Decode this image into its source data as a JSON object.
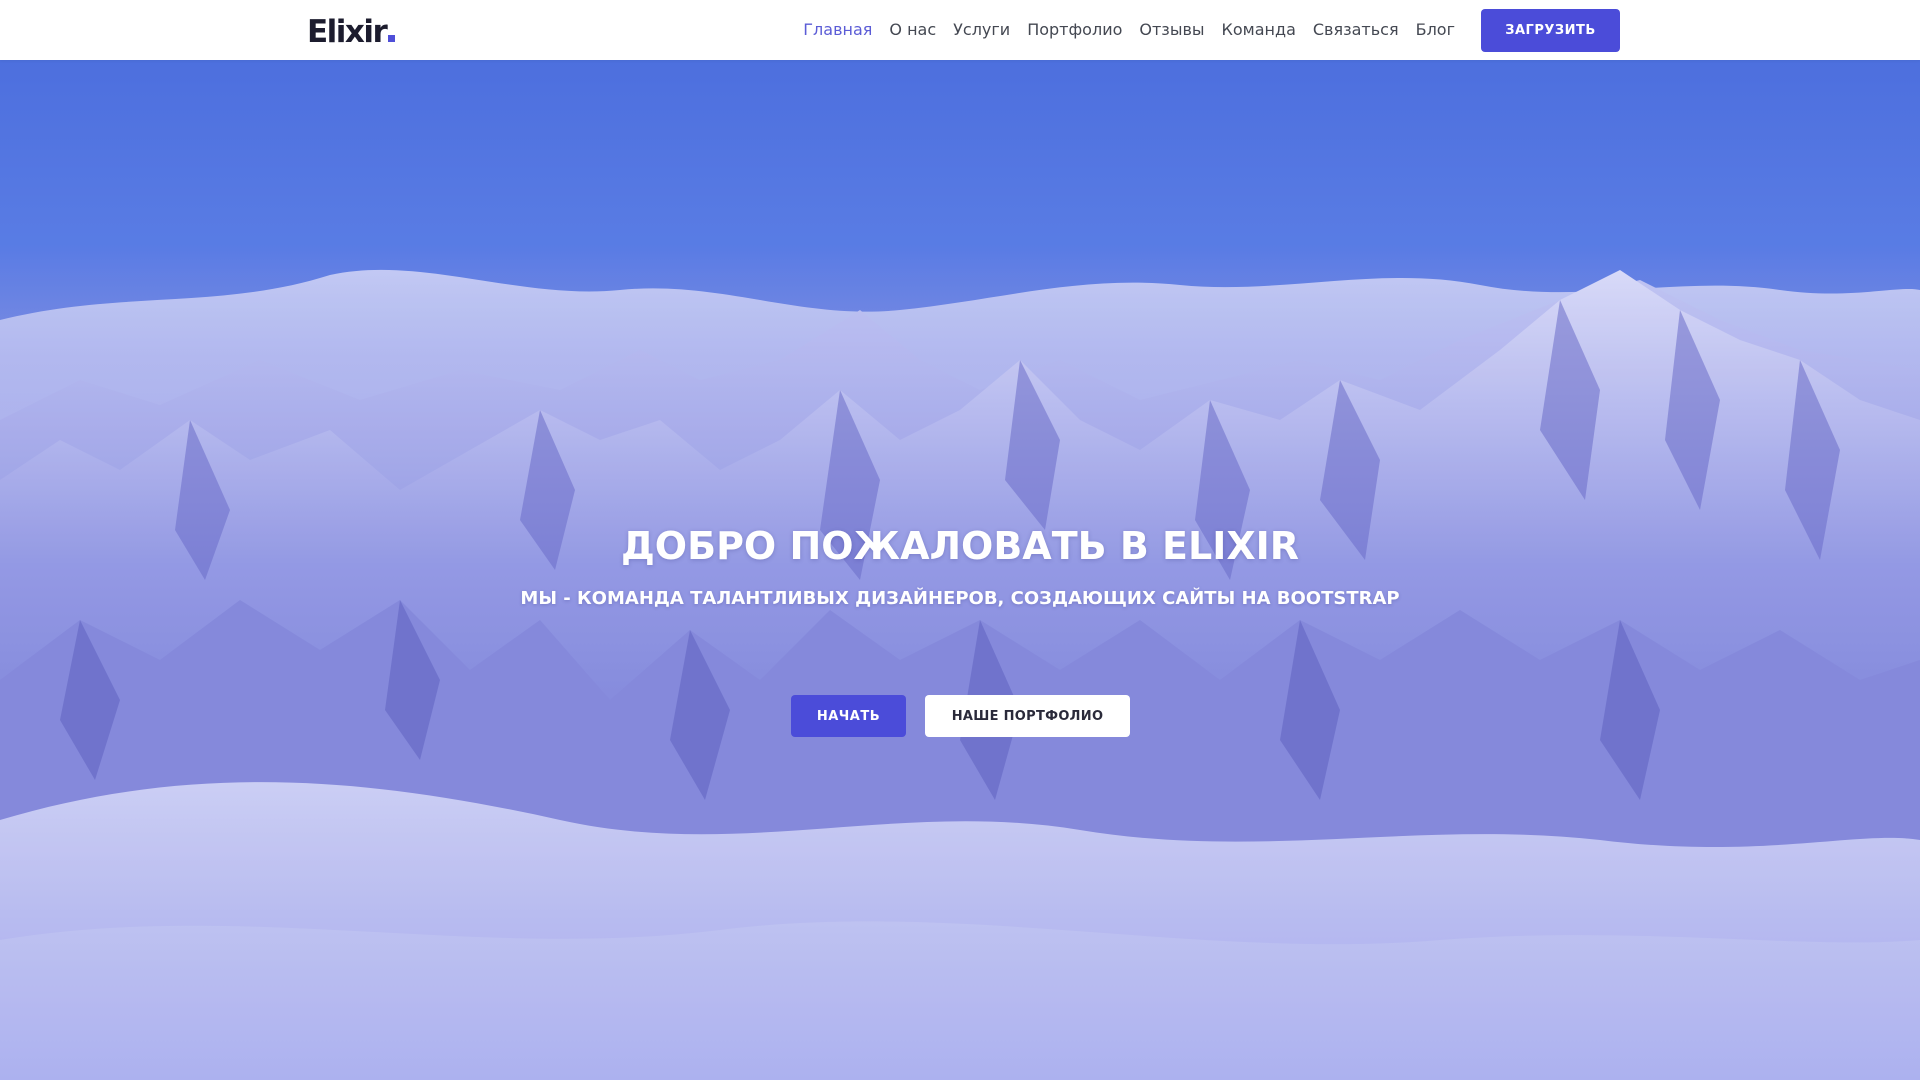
{
  "header": {
    "logo_text": "Elixir",
    "nav": [
      {
        "label": "Главная",
        "active": true
      },
      {
        "label": "О нас"
      },
      {
        "label": "Услуги"
      },
      {
        "label": "Портфолио"
      },
      {
        "label": "Отзывы"
      },
      {
        "label": "Команда"
      },
      {
        "label": "Связаться"
      },
      {
        "label": "Блог"
      }
    ],
    "cta_label": "ЗАГРУЗИТЬ"
  },
  "hero": {
    "title": "ДОБРО ПОЖАЛОВАТЬ В ELIXIR",
    "subtitle": "МЫ - КОМАНДА ТАЛАНТЛИВЫХ ДИЗАЙНЕРОВ, СОЗДАЮЩИХ САЙТЫ НА BOOTSTRAP",
    "primary_button": "НАЧАТЬ",
    "secondary_button": "НАШЕ ПОРТФОЛИО",
    "background_image": "snowy-mountains"
  },
  "colors": {
    "accent": "#4b4cd9",
    "nav_active": "#5b5cd6",
    "header_bg": "#ffffff",
    "hero_tint": "#5a63d6"
  }
}
